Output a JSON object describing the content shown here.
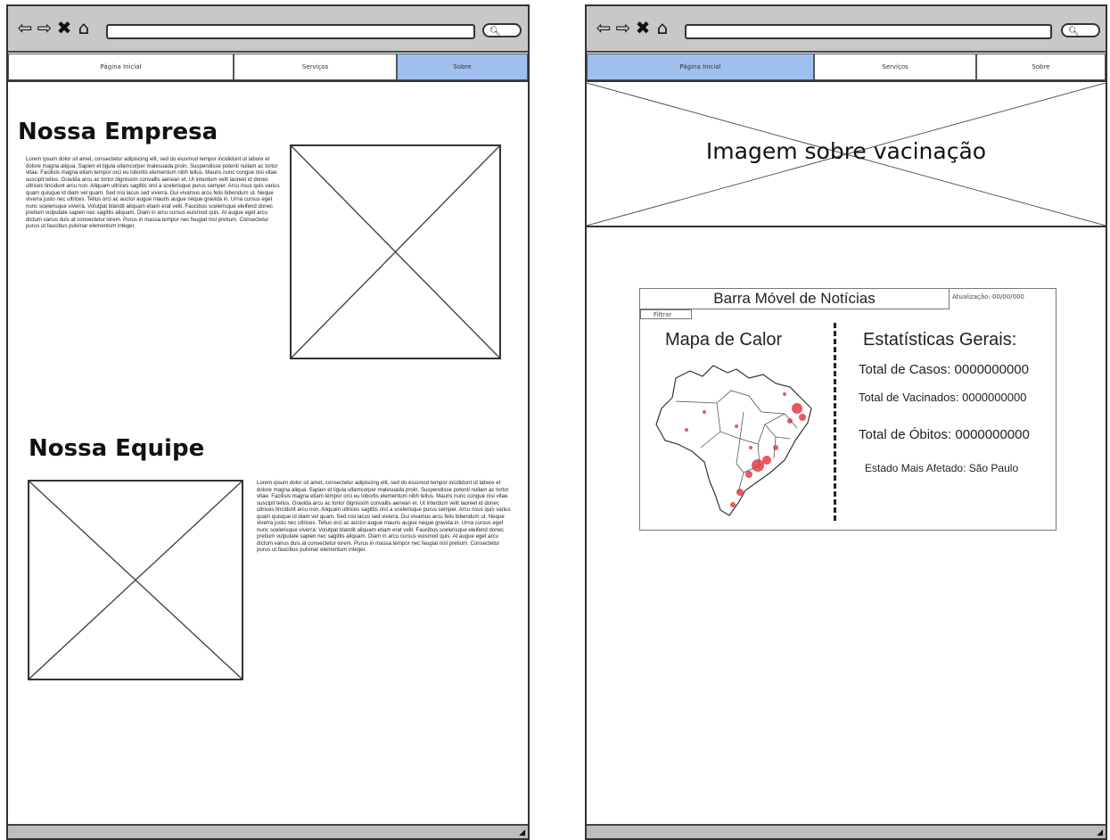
{
  "left_window": {
    "tabs": [
      {
        "label": "Página Inicial",
        "active": false
      },
      {
        "label": "Serviços",
        "active": false
      },
      {
        "label": "Sobre",
        "active": true
      }
    ],
    "section1": {
      "title": "Nossa Empresa",
      "body": "Lorem ipsum dolor sit amet, consectetur adipiscing elit, sed do eiusmod tempor incididunt ut labore et dolore magna aliqua. Sapien et ligula ullamcorper malesuada proin. Suspendisse potenti nullam ac tortor vitae. Facilisis magna etiam tempor orci eu lobortis elementum nibh tellus. Mauris nunc congue nisi vitae suscipit tellus. Gravida arcu ac tortor dignissim convallis aenean et. Ut interdum velit laoreet id donec ultrices tincidunt arcu non. Aliquam ultrices sagittis orci a scelerisque purus semper. Arcu risus quis varius quam quisque id diam vel quam. Sed nisi lacus sed viverra. Dui vivamus arcu felis bibendum ut. Neque viverra justo nec ultrices. Tellus orci ac auctor augue mauris augue neque gravida in. Urna cursus eget nunc scelerisque viverra. Volutpat blandit aliquam etiam erat velit. Faucibus scelerisque eleifend donec pretium vulputate sapien nec sagittis aliquam. Diam in arcu cursus euismod quis. At augue eget arcu dictum varius duis at consectetur lorem. Purus in massa tempor nec feugiat nisl pretium. Consectetur purus ut faucibus pulvinar elementum integer."
    },
    "section2": {
      "title": "Nossa Equipe",
      "body": "Lorem ipsum dolor sit amet, consectetur adipiscing elit, sed do eiusmod tempor incididunt ut labore et dolore magna aliqua. Sapien et ligula ullamcorper malesuada proin. Suspendisse potenti nullam ac tortor vitae. Facilisis magna etiam tempor orci eu lobortis elementum nibh tellus. Mauris nunc congue nisi vitae suscipit tellus. Gravida arcu ac tortor dignissim convallis aenean et. Ut interdum velit laoreet id donec ultrices tincidunt arcu non. Aliquam ultrices sagittis orci a scelerisque purus semper. Arcu risus quis varius quam quisque id diam vel quam. Sed nisi lacus sed viverra. Dui vivamus arcu felis bibendum ut. Neque viverra justo nec ultrices. Tellus orci ac auctor augue mauris augue neque gravida in. Urna cursus eget nunc scelerisque viverra. Volutpat blandit aliquam etiam erat velit. Faucibus scelerisque eleifend donec pretium vulputate sapien nec sagittis aliquam. Diam in arcu cursus euismod quis. At augue eget arcu dictum varius duis at consectetur lorem. Purus in massa tempor nec feugiat nisl pretium. Consectetur purus ut faucibus pulvinar elementum integer."
    }
  },
  "right_window": {
    "tabs": [
      {
        "label": "Página Inicial",
        "active": true
      },
      {
        "label": "Serviços",
        "active": false
      },
      {
        "label": "Sobre",
        "active": false
      }
    ],
    "hero_text": "Imagem sobre vacinação",
    "dashboard": {
      "news_bar": "Barra Móvel de Notícias",
      "update_label": "Atualização: 00/00/000",
      "filter_label": "Filtrar",
      "map_title": "Mapa de Calor",
      "stats_title": "Estatísticas Gerais:",
      "stats": [
        "Total de Casos: 0000000000",
        "Total de Vacinados: 0000000000",
        "Total de Óbitos: 0000000000",
        "Estado Mais Afetado: São Paulo"
      ]
    }
  },
  "icons": [
    "back-arrow-icon",
    "forward-arrow-icon",
    "close-icon",
    "home-icon",
    "search-icon",
    "resize-handle-icon"
  ],
  "colors": {
    "active_tab": "#9fbfef",
    "chrome": "#c8c8c8",
    "heatmap": "#e0303a"
  }
}
